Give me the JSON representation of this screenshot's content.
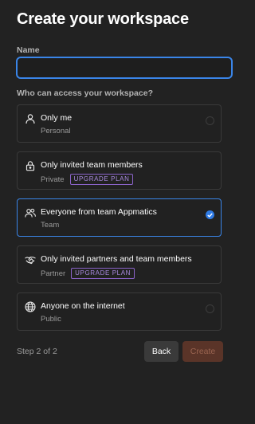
{
  "page": {
    "title": "Create your workspace"
  },
  "form": {
    "name_label": "Name",
    "name_value": "",
    "access_label": "Who can access your workspace?"
  },
  "options": [
    {
      "title": "Only me",
      "subtitle": "Personal",
      "badge": "",
      "icon": "person-icon",
      "selected": false
    },
    {
      "title": "Only invited team members",
      "subtitle": "Private",
      "badge": "UPGRADE PLAN",
      "icon": "lock-icon",
      "selected": false
    },
    {
      "title": "Everyone from team Appmatics",
      "subtitle": "Team",
      "badge": "",
      "icon": "people-icon",
      "selected": true
    },
    {
      "title": "Only invited partners and team members",
      "subtitle": "Partner",
      "badge": "UPGRADE PLAN",
      "icon": "handshake-icon",
      "selected": false
    },
    {
      "title": "Anyone on the internet",
      "subtitle": "Public",
      "badge": "",
      "icon": "globe-icon",
      "selected": false
    }
  ],
  "footer": {
    "step_text": "Step 2 of 2",
    "back_label": "Back",
    "create_label": "Create"
  },
  "colors": {
    "background": "#222222",
    "accent": "#3a85e8",
    "badge": "#8b63c9",
    "create_button": "#5a3428"
  }
}
